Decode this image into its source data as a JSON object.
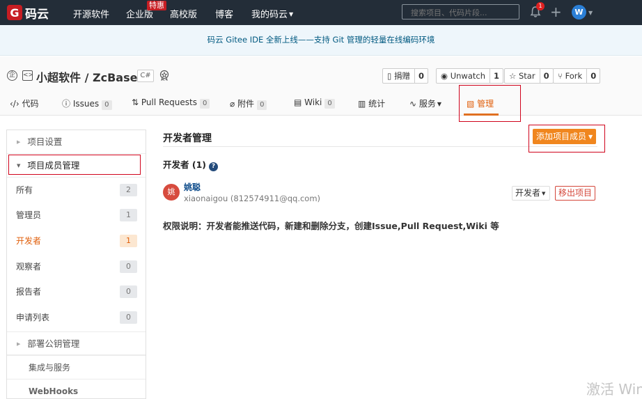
{
  "nav": {
    "logo_letter": "G",
    "logo_text": "码云",
    "items": [
      "开源软件",
      "企业版",
      "高校版",
      "博客",
      "我的码云"
    ],
    "enterprise_badge": "特惠",
    "search_placeholder": "搜索项目、代码片段...",
    "notification_count": "1",
    "plus": "+",
    "user_initial": "W"
  },
  "announcement": "码云 Gitee IDE 全新上线——支持 Git 管理的轻量在线编码环境",
  "repo": {
    "title": "小超软件 / ZcBase",
    "language": "C#",
    "actions": [
      {
        "label": "捐赠",
        "count": "0"
      },
      {
        "label": "Unwatch",
        "count": "1"
      },
      {
        "label": "Star",
        "count": "0"
      },
      {
        "label": "Fork",
        "count": "0"
      }
    ],
    "tabs": [
      {
        "label": "代码",
        "count": ""
      },
      {
        "label": "Issues",
        "count": "0"
      },
      {
        "label": "Pull Requests",
        "count": "0"
      },
      {
        "label": "附件",
        "count": "0"
      },
      {
        "label": "Wiki",
        "count": "0"
      },
      {
        "label": "统计",
        "count": ""
      },
      {
        "label": "服务",
        "count": ""
      },
      {
        "label": "管理",
        "count": ""
      }
    ]
  },
  "sidebar": {
    "group1": "项目设置",
    "group2": "项目成员管理",
    "items": [
      {
        "label": "所有",
        "count": "2"
      },
      {
        "label": "管理员",
        "count": "1"
      },
      {
        "label": "开发者",
        "count": "1"
      },
      {
        "label": "观察者",
        "count": "0"
      },
      {
        "label": "报告者",
        "count": "0"
      },
      {
        "label": "申请列表",
        "count": "0"
      }
    ],
    "group3": "部署公钥管理",
    "sub1": "集成与服务",
    "sub2": "WebHooks"
  },
  "main": {
    "title": "开发者管理",
    "add_button": "添加项目成员",
    "section_heading": "开发者 (1)",
    "help": "?",
    "member": {
      "avatar_char": "姚",
      "name": "姚聪",
      "account": "xiaonaigou (812574911@qq.com)",
      "role": "开发者",
      "remove_label": "移出项目"
    },
    "permission_note": "权限说明：开发者能推送代码，新建和删除分支，创建Issue,Pull Request,Wiki 等"
  },
  "watermark": "激活 Win"
}
